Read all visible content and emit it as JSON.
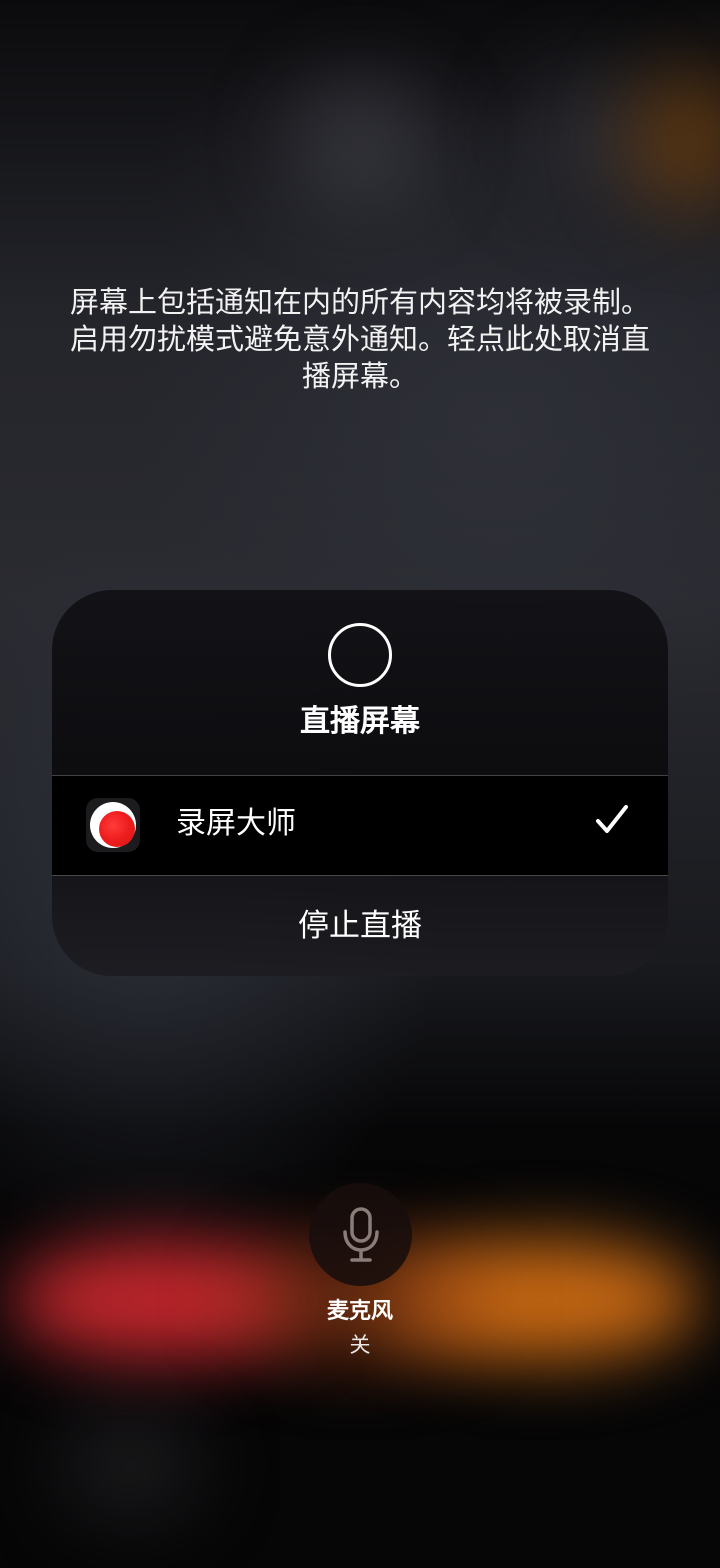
{
  "notice": {
    "text": "屏幕上包括通知在内的所有内容均将被录制。启用勿扰模式避免意外通知。轻点此处取消直播屏幕。"
  },
  "broadcast_sheet": {
    "icon": "record-circle-icon",
    "title": "直播屏幕",
    "apps": [
      {
        "name": "录屏大师",
        "icon": "record-dot-icon",
        "selected": true,
        "selected_icon": "checkmark-icon"
      }
    ],
    "stop_label": "停止直播"
  },
  "microphone": {
    "icon": "microphone-icon",
    "label": "麦克风",
    "state": "关"
  },
  "colors": {
    "accent_red": "#ee1d1d",
    "glow_red": "#c8282d",
    "glow_orange": "#d26e14",
    "text_primary": "#ffffff"
  }
}
